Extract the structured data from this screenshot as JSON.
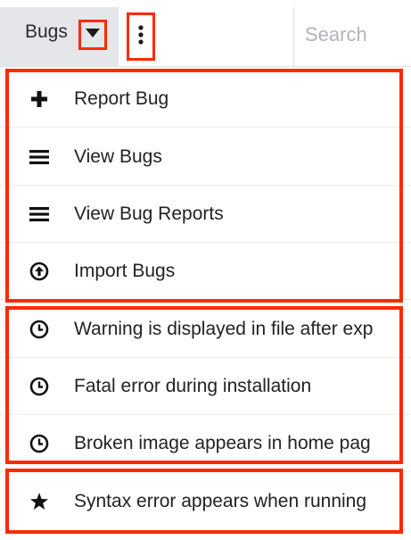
{
  "tab": {
    "label": "Bugs"
  },
  "search": {
    "placeholder": "Search"
  },
  "menu": {
    "actions": [
      {
        "label": "Report Bug",
        "icon": "plus-icon"
      },
      {
        "label": "View Bugs",
        "icon": "list-icon"
      },
      {
        "label": "View Bug Reports",
        "icon": "list-icon"
      },
      {
        "label": "Import Bugs",
        "icon": "upload-circle-icon"
      }
    ],
    "recent": [
      {
        "label": "Warning is displayed in file after exp",
        "icon": "clock-icon"
      },
      {
        "label": "Fatal error during installation",
        "icon": "clock-icon"
      },
      {
        "label": "Broken image appears in home pag",
        "icon": "clock-icon"
      }
    ],
    "favorites": [
      {
        "label": "Syntax error appears when running",
        "icon": "star-icon"
      }
    ]
  },
  "colors": {
    "highlight": "#ff2a00",
    "tab_bg": "#e4e6ea",
    "search_text": "#b0b3b8"
  }
}
